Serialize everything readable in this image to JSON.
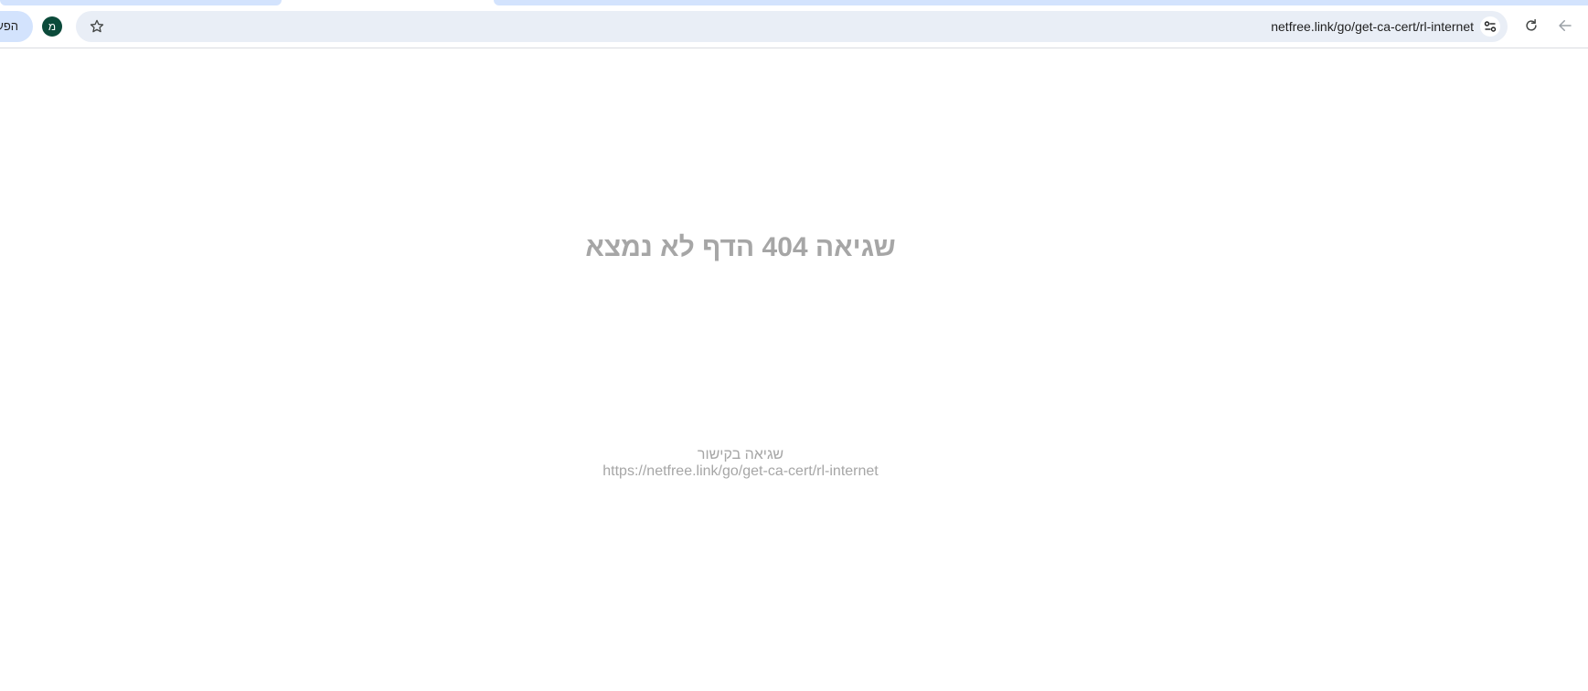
{
  "browser": {
    "profile_chip_label": "הפעל",
    "avatar_letter": "מ",
    "url": "netfree.link/go/get-ca-cert/rl-internet"
  },
  "page": {
    "title": "שגיאה 404 הדף לא נמצא",
    "subtitle": "שגיאה בקישור",
    "link_text": "https://netfree.link/go/get-ca-cert/rl-internet"
  },
  "icons": {
    "bookmark": "star-icon",
    "site_info": "tune-icon",
    "reload": "reload-icon",
    "back": "back-arrow-icon"
  },
  "colors": {
    "error_text": "#a6a6a6",
    "omnibox_bg": "#e9eef6",
    "tab_bg": "#d3e3fd",
    "avatar_bg": "#0b4a3a"
  }
}
